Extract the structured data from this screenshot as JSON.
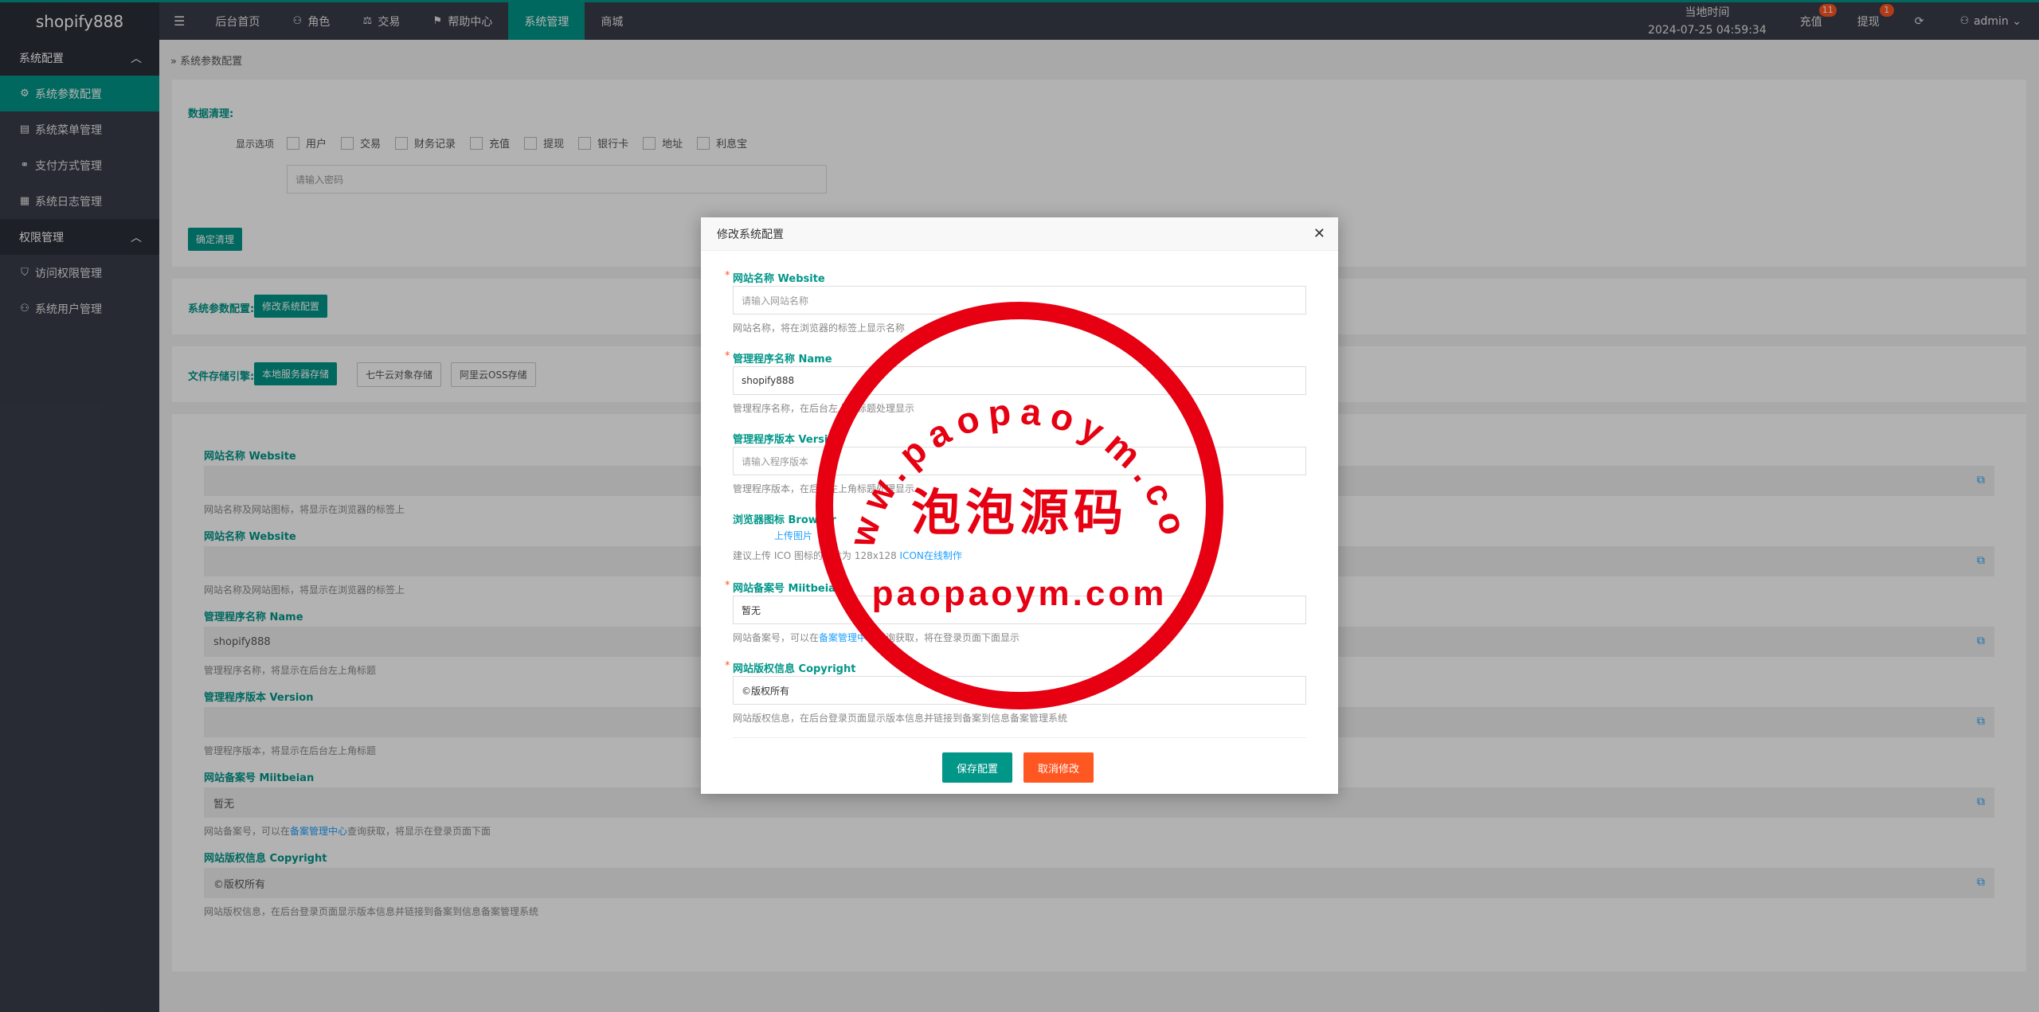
{
  "app": {
    "logo": "shopify888"
  },
  "topnav": {
    "items": [
      {
        "label": "后台首页",
        "icon": ""
      },
      {
        "label": "角色",
        "icon": "user-icon"
      },
      {
        "label": "交易",
        "icon": "scale-icon"
      },
      {
        "label": "帮助中心",
        "icon": "flag-icon"
      },
      {
        "label": "系统管理",
        "icon": ""
      },
      {
        "label": "商城",
        "icon": ""
      }
    ],
    "clock_label": "当地时间",
    "clock_value": "2024-07-25 04:59:34",
    "recharge": "充值",
    "recharge_badge": "11",
    "withdraw": "提现",
    "withdraw_badge": "1",
    "user": "admin"
  },
  "sidebar": {
    "group1": "系统配置",
    "items1": [
      "系统参数配置",
      "系统菜单管理",
      "支付方式管理",
      "系统日志管理"
    ],
    "group2": "权限管理",
    "items2": [
      "访问权限管理",
      "系统用户管理"
    ]
  },
  "breadcrumb": "系统参数配置",
  "cleanup": {
    "title": "数据清理:",
    "option_label": "显示选项",
    "options": [
      "用户",
      "交易",
      "财务记录",
      "充值",
      "提现",
      "银行卡",
      "地址",
      "利息宝"
    ],
    "password_placeholder": "请输入密码",
    "confirm": "确定清理"
  },
  "sysparam": {
    "label": "系统参数配置:",
    "button": "修改系统配置"
  },
  "storage": {
    "label": "文件存储引擎:",
    "options": [
      "本地服务器存储",
      "七牛云对象存储",
      "阿里云OSS存储"
    ]
  },
  "readonly_fields": [
    {
      "label": "网站名称 Website",
      "value": "",
      "hint": "网站名称及网站图标，将显示在浏览器的标签上"
    },
    {
      "label": "网站名称 Website",
      "value": "",
      "hint": "网站名称及网站图标，将显示在浏览器的标签上"
    },
    {
      "label": "管理程序名称 Name",
      "value": "shopify888",
      "hint": "管理程序名称，将显示在后台左上角标题"
    },
    {
      "label": "管理程序版本 Version",
      "value": "",
      "hint": "管理程序版本，将显示在后台左上角标题"
    },
    {
      "label": "网站备案号 Miitbeian",
      "value": "暂无",
      "hint_pre": "网站备案号，可以在",
      "hint_link": "备案管理中心",
      "hint_post": "查询获取，将显示在登录页面下面"
    },
    {
      "label": "网站版权信息 Copyright",
      "value": "©版权所有",
      "hint": "网站版权信息，在后台登录页面显示版本信息并链接到备案到信息备案管理系统"
    }
  ],
  "modal": {
    "title": "修改系统配置",
    "f1_label": "网站名称 Website",
    "f1_placeholder": "请输入网站名称",
    "f1_hint": "网站名称，将在浏览器的标签上显示名称",
    "f2_label": "管理程序名称 Name",
    "f2_value": "shopify888",
    "f2_hint": "管理程序名称，在后台左上角标题处理显示",
    "f3_label": "管理程序版本 Version",
    "f3_placeholder": "请输入程序版本",
    "f3_hint": "管理程序版本，在后台左上角标题处理显示",
    "f4_label": "浏览器图标 Browser",
    "f4_upload": "上传图片",
    "f4_hint_pre": "建议上传 ICO 图标的尺寸为 128x128",
    "f4_hint_link": "ICON在线制作",
    "f5_label": "网站备案号 Miitbeian",
    "f5_value": "暂无",
    "f5_hint_pre": "网站备案号，可以在",
    "f5_hint_link": "备案管理中心",
    "f5_hint_post": "查询获取，将在登录页面下面显示",
    "f6_label": "网站版权信息 Copyright",
    "f6_value": "©版权所有",
    "f6_hint": "网站版权信息，在后台登录页面显示版本信息并链接到备案到信息备案管理系统",
    "save": "保存配置",
    "cancel": "取消修改"
  },
  "watermark": {
    "url_arc": "www.paopaoym.com",
    "title": "泡泡源码",
    "domain": "paopaoym.com"
  },
  "colors": {
    "accent": "#009688",
    "danger": "#ff5722",
    "stamp": "#e60012",
    "dark": "#393d49"
  }
}
